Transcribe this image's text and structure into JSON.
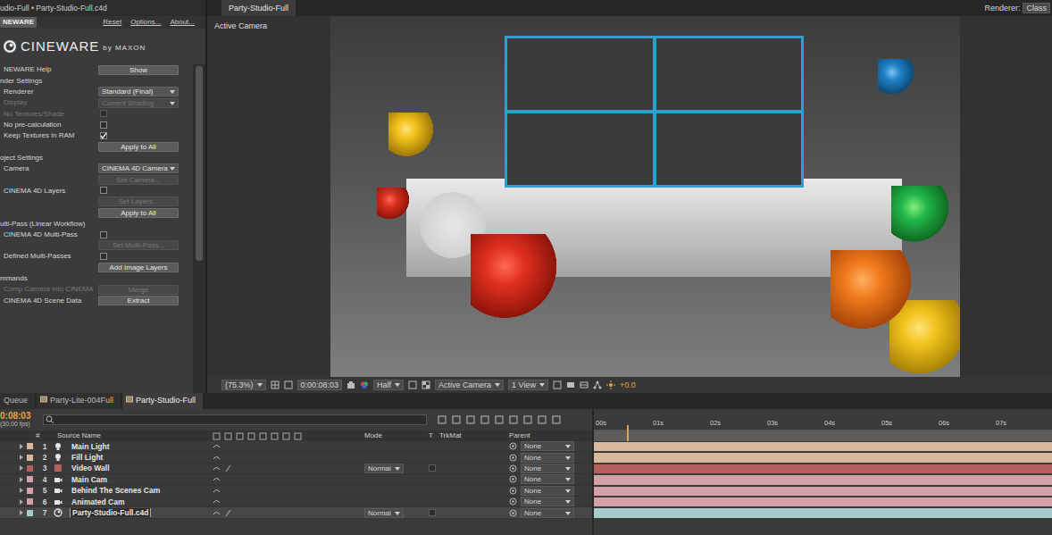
{
  "effect_panel": {
    "title": "udio-Full • Party-Studio-Full.c4d",
    "tab": "NEWARE",
    "links": [
      "Reset",
      "Options...",
      "About..."
    ],
    "logo": {
      "name": "CINEWARE",
      "by": "by MAXON"
    },
    "params": [
      {
        "kind": "button",
        "label": "NEWARE Help",
        "button": "Show",
        "disabled": false
      },
      {
        "kind": "section",
        "label": "nder Settings",
        "disabled": false
      },
      {
        "kind": "dropdown",
        "label": "Renderer",
        "value": "Standard (Final)",
        "disabled": false
      },
      {
        "kind": "dropdown",
        "label": "Display",
        "value": "Current Shading",
        "disabled": true
      },
      {
        "kind": "checkbox",
        "label": "No Textures/Shade",
        "checked": false,
        "disabled": true
      },
      {
        "kind": "checkbox",
        "label": "No pre-calculation",
        "checked": false,
        "disabled": false
      },
      {
        "kind": "checkbox",
        "label": "Keep Textures in RAM",
        "checked": true,
        "disabled": false
      },
      {
        "kind": "action",
        "button": "Apply to All",
        "disabled": false
      },
      {
        "kind": "section",
        "label": "oject Settings",
        "disabled": false
      },
      {
        "kind": "dropdown",
        "label": "Camera",
        "value": "CINEMA 4D Camera",
        "disabled": false
      },
      {
        "kind": "action",
        "button": "Set Camera...",
        "disabled": true
      },
      {
        "kind": "checkbox",
        "label": "CINEMA 4D Layers",
        "checked": false,
        "disabled": false
      },
      {
        "kind": "action",
        "button": "Set Layers...",
        "disabled": true
      },
      {
        "kind": "action",
        "button": "Apply to All",
        "disabled": false
      },
      {
        "kind": "section",
        "label": "ulti-Pass (Linear Workflow)",
        "disabled": false
      },
      {
        "kind": "checkbox",
        "label": "CINEMA 4D Multi-Pass",
        "checked": false,
        "disabled": false
      },
      {
        "kind": "action",
        "button": "Set Multi-Pass...",
        "disabled": true
      },
      {
        "kind": "checkbox",
        "label": "Defined Multi-Passes",
        "checked": false,
        "disabled": false
      },
      {
        "kind": "action",
        "button": "Add Image Layers",
        "disabled": false
      },
      {
        "kind": "section",
        "label": "mmands",
        "disabled": false
      },
      {
        "kind": "button",
        "label": "Comp Camera into CINEMA",
        "button": "Merge",
        "disabled": true
      },
      {
        "kind": "button",
        "label": "CINEMA 4D Scene Data",
        "button": "Extract",
        "disabled": false
      }
    ]
  },
  "viewer": {
    "tab": "Party-Studio-Full",
    "renderer_label": "Renderer:",
    "renderer_value": "Class",
    "camera_label": "Active Camera",
    "toolbar": {
      "zoom": "(75.3%)",
      "timecode": "0:00:08:03",
      "resolution": "Half",
      "view": "Active Camera",
      "layout": "1 View",
      "exposure": "+0.0"
    }
  },
  "comp_tabs": [
    {
      "label": "Queue",
      "selected": false
    },
    {
      "label": "Party-Lite-004Full",
      "selected": false
    },
    {
      "label": "Party-Studio-Full",
      "selected": true
    }
  ],
  "timeline": {
    "time": "0:08:03",
    "fps": "(30.00 fps)",
    "columns": [
      "#",
      "Source Name",
      "Mode",
      "T",
      "TrkMat",
      "Parent"
    ],
    "ruler": [
      "00s",
      "01s",
      "02s",
      "03s",
      "04s",
      "05s",
      "06s",
      "07s"
    ],
    "playhead": {
      "level": 0.072
    },
    "layers": [
      {
        "num": "1",
        "name": "Main Light",
        "kind": "light",
        "color": "#d8b99b",
        "parent": "None",
        "selected": false
      },
      {
        "num": "2",
        "name": "Fill Light",
        "kind": "light",
        "color": "#d8b99b",
        "parent": "None",
        "selected": false
      },
      {
        "num": "3",
        "name": "Video Wall",
        "kind": "solid",
        "color": "#b5605f",
        "mode": "Normal",
        "parent": "None",
        "selected": false
      },
      {
        "num": "4",
        "name": "Main Cam",
        "kind": "camera",
        "color": "#d3a1a8",
        "parent": "None",
        "selected": false
      },
      {
        "num": "5",
        "name": "Behind The Scenes Cam",
        "kind": "camera",
        "color": "#d3a1a8",
        "parent": "None",
        "selected": false
      },
      {
        "num": "6",
        "name": "Animated Cam",
        "kind": "camera",
        "color": "#d3a1a8",
        "parent": "None",
        "selected": false
      },
      {
        "num": "7",
        "name": "Party-Studio-Full.c4d",
        "kind": "c4d",
        "color": "#a6cccd",
        "mode": "Normal",
        "parent": "None",
        "selected": true
      }
    ]
  }
}
